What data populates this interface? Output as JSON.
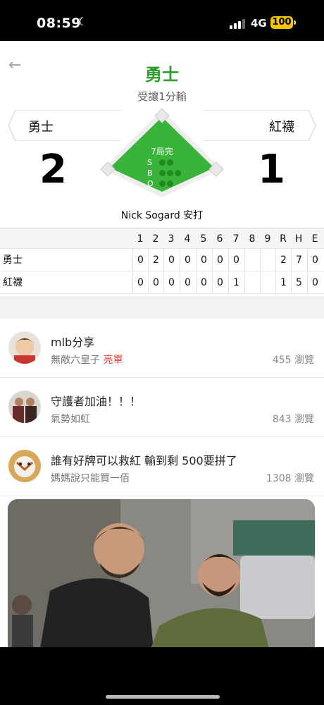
{
  "status": {
    "time": "08:59",
    "network": "4G",
    "battery": "100"
  },
  "header": {
    "title": "勇士",
    "subtitle": "受讓1分輸"
  },
  "game": {
    "away": {
      "name": "勇士",
      "score": "2"
    },
    "home": {
      "name": "紅襪",
      "score": "1"
    },
    "inning": "7局完",
    "sbo": {
      "s": "S",
      "b": "B",
      "o": "O"
    },
    "play": "Nick Sogard 安打"
  },
  "boxscore": {
    "headers": [
      "1",
      "2",
      "3",
      "4",
      "5",
      "6",
      "7",
      "8",
      "9",
      "R",
      "H",
      "E"
    ],
    "rows": [
      {
        "team": "勇士",
        "cells": [
          "0",
          "2",
          "0",
          "0",
          "0",
          "0",
          "0",
          "",
          "",
          "2",
          "7",
          "0"
        ]
      },
      {
        "team": "紅襪",
        "cells": [
          "0",
          "0",
          "0",
          "0",
          "0",
          "0",
          "1",
          "",
          "",
          "1",
          "5",
          "0"
        ]
      }
    ]
  },
  "posts": [
    {
      "title": "mlb分享",
      "author": "無敵六皇子",
      "tag": "亮單",
      "views": "455 瀏覽"
    },
    {
      "title": "守護者加油！！！",
      "author": "氣勢如虹",
      "tag": "",
      "views": "843 瀏覽"
    },
    {
      "title": "誰有好牌可以救紅 輸到剩 500要拼了",
      "author": "媽媽說只能買一佰",
      "tag": "",
      "views": "1308 瀏覽"
    }
  ],
  "colors": {
    "accent": "#2e9d2e",
    "tag": "#e53935"
  }
}
